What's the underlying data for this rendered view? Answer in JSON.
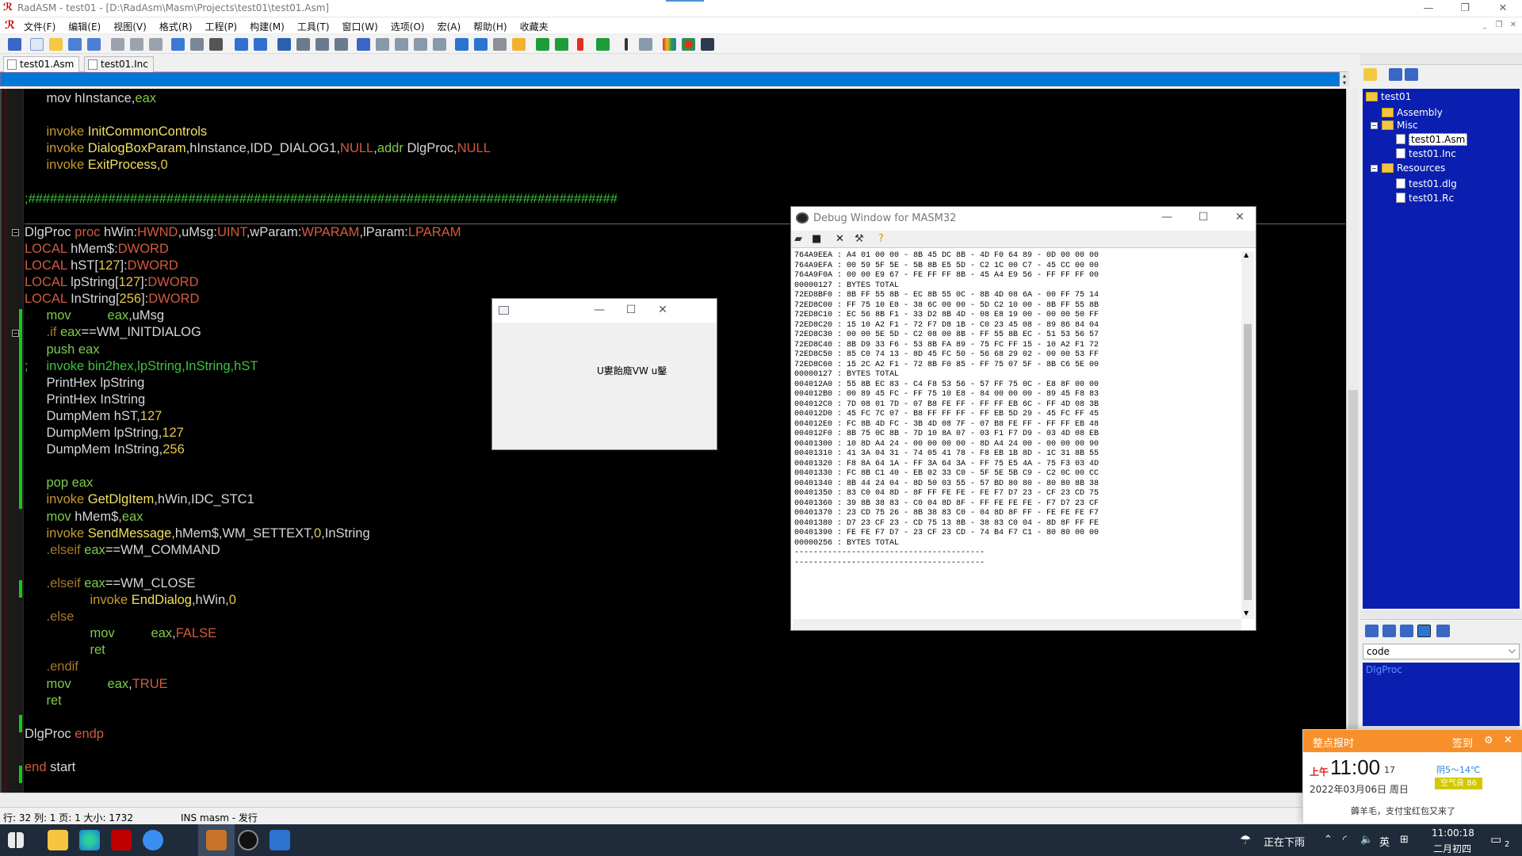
{
  "window": {
    "title": "RadASM - test01 - [D:\\RadAsm\\Masm\\Projects\\test01\\test01.Asm]",
    "minimize": "—",
    "restore": "❐",
    "close": "✕"
  },
  "menu": [
    "文件(F)",
    "编辑(E)",
    "视图(V)",
    "格式(R)",
    "工程(P)",
    "构建(M)",
    "工具(T)",
    "窗口(W)",
    "选项(O)",
    "宏(A)",
    "帮助(H)",
    "收藏夹"
  ],
  "tabs": [
    "test01.Asm",
    "test01.Inc"
  ],
  "code_lines": [
    {
      "id": "l1",
      "row": 0,
      "parts": [
        [
          "txt",
          "      mov hInstance,"
        ],
        [
          "kw",
          "eax"
        ]
      ]
    },
    {
      "id": "l2",
      "row": 2,
      "parts": [
        [
          "inv",
          "      invoke "
        ],
        [
          "fn",
          "InitCommonControls"
        ]
      ]
    },
    {
      "id": "l3",
      "row": 3,
      "parts": [
        [
          "inv",
          "      invoke "
        ],
        [
          "fn",
          "DialogBoxParam"
        ],
        [
          "txt",
          ",hInstance,IDD_DIALOG1,"
        ],
        [
          "red",
          "NULL"
        ],
        [
          "txt",
          ","
        ],
        [
          "kw",
          "addr "
        ],
        [
          "txt",
          "DlgProc,"
        ],
        [
          "red",
          "NULL"
        ]
      ]
    },
    {
      "id": "l4",
      "row": 4,
      "parts": [
        [
          "inv",
          "      invoke "
        ],
        [
          "fn",
          "ExitProcess"
        ],
        [
          "txt",
          ","
        ],
        [
          "num",
          "0"
        ]
      ]
    },
    {
      "id": "l5",
      "row": 6,
      "parts": [
        [
          "cmt",
          ";#################################################################################"
        ]
      ]
    },
    {
      "id": "l6",
      "row": 8,
      "parts": [
        [
          "txt",
          "DlgProc "
        ],
        [
          "red",
          "proc "
        ],
        [
          "txt",
          "hWin:"
        ],
        [
          "red",
          "HWND"
        ],
        [
          "txt",
          ",uMsg:"
        ],
        [
          "red",
          "UINT"
        ],
        [
          "txt",
          ",wParam:"
        ],
        [
          "red",
          "WPARAM"
        ],
        [
          "txt",
          ",lParam:"
        ],
        [
          "red",
          "LPARAM"
        ]
      ]
    },
    {
      "id": "l7",
      "row": 9,
      "parts": [
        [
          "red",
          "LOCAL "
        ],
        [
          "txt",
          "hMem$:"
        ],
        [
          "red",
          "DWORD"
        ]
      ]
    },
    {
      "id": "l8",
      "row": 10,
      "parts": [
        [
          "red",
          "LOCAL "
        ],
        [
          "txt",
          "hST["
        ],
        [
          "num",
          "127"
        ],
        [
          "txt",
          "]:"
        ],
        [
          "red",
          "DWORD"
        ]
      ]
    },
    {
      "id": "l9",
      "row": 11,
      "parts": [
        [
          "red",
          "LOCAL "
        ],
        [
          "txt",
          "lpString["
        ],
        [
          "num",
          "127"
        ],
        [
          "txt",
          "]:"
        ],
        [
          "red",
          "DWORD"
        ]
      ]
    },
    {
      "id": "l10",
      "row": 12,
      "parts": [
        [
          "red",
          "LOCAL "
        ],
        [
          "txt",
          "InString["
        ],
        [
          "num",
          "256"
        ],
        [
          "txt",
          "]:"
        ],
        [
          "red",
          "DWORD"
        ]
      ]
    },
    {
      "id": "l11",
      "row": 13,
      "parts": [
        [
          "kw",
          "      mov          eax"
        ],
        [
          "txt",
          ",uMsg"
        ]
      ]
    },
    {
      "id": "l12",
      "row": 14,
      "parts": [
        [
          "dir",
          "      .if "
        ],
        [
          "kw",
          "eax"
        ],
        [
          "txt",
          "==WM_INITDIALOG"
        ]
      ]
    },
    {
      "id": "l13",
      "row": 15,
      "parts": [
        [
          "kw",
          "      push eax"
        ]
      ]
    },
    {
      "id": "l14",
      "row": 16,
      "parts": [
        [
          "cmt",
          ";     invoke bin2hex,lpString,InString,hST"
        ]
      ]
    },
    {
      "id": "l15",
      "row": 17,
      "parts": [
        [
          "txt",
          "      PrintHex lpString"
        ]
      ]
    },
    {
      "id": "l16",
      "row": 18,
      "parts": [
        [
          "txt",
          "      PrintHex InString"
        ]
      ]
    },
    {
      "id": "l17",
      "row": 19,
      "parts": [
        [
          "txt",
          "      DumpMem hST,"
        ],
        [
          "num",
          "127"
        ]
      ]
    },
    {
      "id": "l18",
      "row": 20,
      "parts": [
        [
          "txt",
          "      DumpMem lpString,"
        ],
        [
          "num",
          "127"
        ]
      ]
    },
    {
      "id": "l19",
      "row": 21,
      "parts": [
        [
          "txt",
          "      DumpMem InString,"
        ],
        [
          "num",
          "256"
        ]
      ]
    },
    {
      "id": "l20",
      "row": 23,
      "parts": [
        [
          "kw",
          "      pop eax"
        ]
      ]
    },
    {
      "id": "l21",
      "row": 24,
      "parts": [
        [
          "inv",
          "      invoke "
        ],
        [
          "fn",
          "GetDlgItem"
        ],
        [
          "txt",
          ",hWin,IDC_STC1"
        ]
      ]
    },
    {
      "id": "l22",
      "row": 25,
      "parts": [
        [
          "kw",
          "      mov "
        ],
        [
          "txt",
          "hMem$,"
        ],
        [
          "kw",
          "eax"
        ]
      ]
    },
    {
      "id": "l23",
      "row": 26,
      "parts": [
        [
          "inv",
          "      invoke "
        ],
        [
          "fn",
          "SendMessage"
        ],
        [
          "txt",
          ",hMem$,WM_SETTEXT,"
        ],
        [
          "num",
          "0"
        ],
        [
          "txt",
          ",InString"
        ]
      ]
    },
    {
      "id": "l24",
      "row": 27,
      "parts": [
        [
          "dir",
          "      .elseif "
        ],
        [
          "kw",
          "eax"
        ],
        [
          "txt",
          "==WM_COMMAND"
        ]
      ]
    },
    {
      "id": "l25",
      "row": 29,
      "parts": [
        [
          "dir",
          "      .elseif "
        ],
        [
          "kw",
          "eax"
        ],
        [
          "txt",
          "==WM_CLOSE"
        ]
      ]
    },
    {
      "id": "l26",
      "row": 30,
      "parts": [
        [
          "inv",
          "                  invoke "
        ],
        [
          "fn",
          "EndDialog"
        ],
        [
          "txt",
          ",hWin,"
        ],
        [
          "num",
          "0"
        ]
      ]
    },
    {
      "id": "l27",
      "row": 31,
      "parts": [
        [
          "dir",
          "      .else"
        ]
      ]
    },
    {
      "id": "l28",
      "row": 32,
      "parts": [
        [
          "kw",
          "                  mov          eax"
        ],
        [
          "txt",
          ","
        ],
        [
          "red",
          "FALSE"
        ]
      ]
    },
    {
      "id": "l29",
      "row": 33,
      "parts": [
        [
          "kw",
          "                  ret"
        ]
      ]
    },
    {
      "id": "l30",
      "row": 34,
      "parts": [
        [
          "dir",
          "      .endif"
        ]
      ]
    },
    {
      "id": "l31",
      "row": 35,
      "parts": [
        [
          "kw",
          "      mov          eax"
        ],
        [
          "txt",
          ","
        ],
        [
          "red",
          "TRUE"
        ]
      ]
    },
    {
      "id": "l32",
      "row": 36,
      "parts": [
        [
          "kw",
          "      ret"
        ]
      ]
    },
    {
      "id": "l33",
      "row": 38,
      "parts": [
        [
          "txt",
          "DlgProc "
        ],
        [
          "red",
          "endp"
        ]
      ]
    },
    {
      "id": "l34",
      "row": 40,
      "parts": [
        [
          "red",
          "end "
        ],
        [
          "txt",
          "start"
        ]
      ]
    }
  ],
  "status": {
    "position": "行: 32   列: 1 页: 1 大小: 1732",
    "mode": "INS masm - 发行"
  },
  "project_tree": {
    "root": "test01",
    "assembly": "Assembly",
    "misc": "Misc",
    "asm_file": "test01.Asm",
    "inc_file": "test01.Inc",
    "resources": "Resources",
    "dlg_file": "test01.dlg",
    "rc_file": "test01.Rc"
  },
  "props": {
    "combo": "code",
    "selected": "DlgProc",
    "combo_arrow": "⌵"
  },
  "debug": {
    "title": "Debug Window for MASM32",
    "dump_lines": [
      "764A9EEA : A4 01 00 00 - 8B 45 DC 8B - 4D F0 64 89 - 0D 00 00 00",
      "764A9EFA : 00 59 5F 5E - 5B 8B E5 5D - C2 1C 00 C7 - 45 CC 00 00",
      "764A9F0A : 00 00 E9 67 - FE FF FF 8B - 45 A4 E9 56 - FF FF FF 00",
      "00000127 : BYTES TOTAL",
      "72ED8BF0 : 8B FF 55 8B - EC 8B 55 0C - 8B 4D 08 6A - 00 FF 75 14",
      "72ED8C00 : FF 75 10 E8 - 38 6C 00 00 - 5D C2 10 00 - 8B FF 55 8B",
      "72ED8C10 : EC 56 8B F1 - 33 D2 8B 4D - 08 E8 19 00 - 00 00 50 FF",
      "72ED8C20 : 15 10 A2 F1 - 72 F7 D8 1B - C0 23 45 08 - 89 86 84 04",
      "72ED8C30 : 00 00 5E 5D - C2 08 00 8B - FF 55 8B EC - 51 53 56 57",
      "72ED8C40 : 8B D9 33 F6 - 53 8B FA 89 - 75 FC FF 15 - 10 A2 F1 72",
      "72ED8C50 : 85 C0 74 13 - 8D 45 FC 50 - 56 68 29 02 - 00 00 53 FF",
      "72ED8C60 : 15 2C A2 F1 - 72 8B F0 85 - FF 75 07 5F - 8B C6 5E 00",
      "00000127 : BYTES TOTAL",
      "004012A0 : 55 8B EC 83 - C4 F8 53 56 - 57 FF 75 0C - E8 8F 00 00",
      "004012B0 : 00 89 45 FC - FF 75 10 E8 - 84 00 00 00 - 89 45 F8 83",
      "004012C0 : 7D 08 01 7D - 07 B8 FE FF - FF FF EB 6C - FF 4D 08 3B",
      "004012D0 : 45 FC 7C 07 - B8 FF FF FF - FF EB 5D 29 - 45 FC FF 45",
      "004012E0 : FC 8B 4D FC - 3B 4D 08 7F - 07 B8 FE FF - FF FF EB 48",
      "004012F0 : 8B 75 0C 8B - 7D 10 8A 07 - 03 F1 F7 D9 - 03 4D 08 EB",
      "00401300 : 10 8D A4 24 - 00 00 00 00 - 8D A4 24 00 - 00 00 00 90",
      "00401310 : 41 3A 04 31 - 74 05 41 78 - F8 EB 1B 8D - 1C 31 8B 55",
      "00401320 : F8 8A 64 1A - FF 3A 64 3A - FF 75 E5 4A - 75 F3 03 4D",
      "00401330 : FC 8B C1 40 - EB 02 33 C0 - 5F 5E 5B C9 - C2 0C 00 CC",
      "00401340 : 8B 44 24 04 - 8D 50 03 55 - 57 BD 80 80 - 80 80 8B 38",
      "00401350 : 83 C0 04 8D - 8F FF FE FE - FE F7 D7 23 - CF 23 CD 75",
      "00401360 : 39 8B 38 83 - C0 04 8D 8F - FF FE FE FE - F7 D7 23 CF",
      "00401370 : 23 CD 75 26 - 8B 38 83 C0 - 04 8D 8F FF - FE FE FE F7",
      "00401380 : D7 23 CF 23 - CD 75 13 8B - 38 83 C0 04 - 8D 8F FF FE",
      "00401390 : FE FE F7 D7 - 23 CF 23 CD - 74 B4 F7 C1 - 80 80 00 00",
      "00000256 : BYTES TOTAL",
      "----------------------------------------",
      "----------------------------------------"
    ]
  },
  "small_dialog": {
    "static_text": "U婁飴廕VW  u鑿"
  },
  "notification": {
    "title": "整点报时",
    "sign": "签到",
    "am": "上午",
    "time": "11:00",
    "seconds": "17",
    "date": "2022年03月06日  周日",
    "weather": "阴5～14℃",
    "air": "空气良 86",
    "message": "薅羊毛，支付宝红包又来了"
  },
  "taskbar": {
    "weather_text": "正在下雨",
    "lang": "英",
    "clock_time": "11:00:18",
    "clock_date": "二月初四",
    "notif_count": "2"
  }
}
